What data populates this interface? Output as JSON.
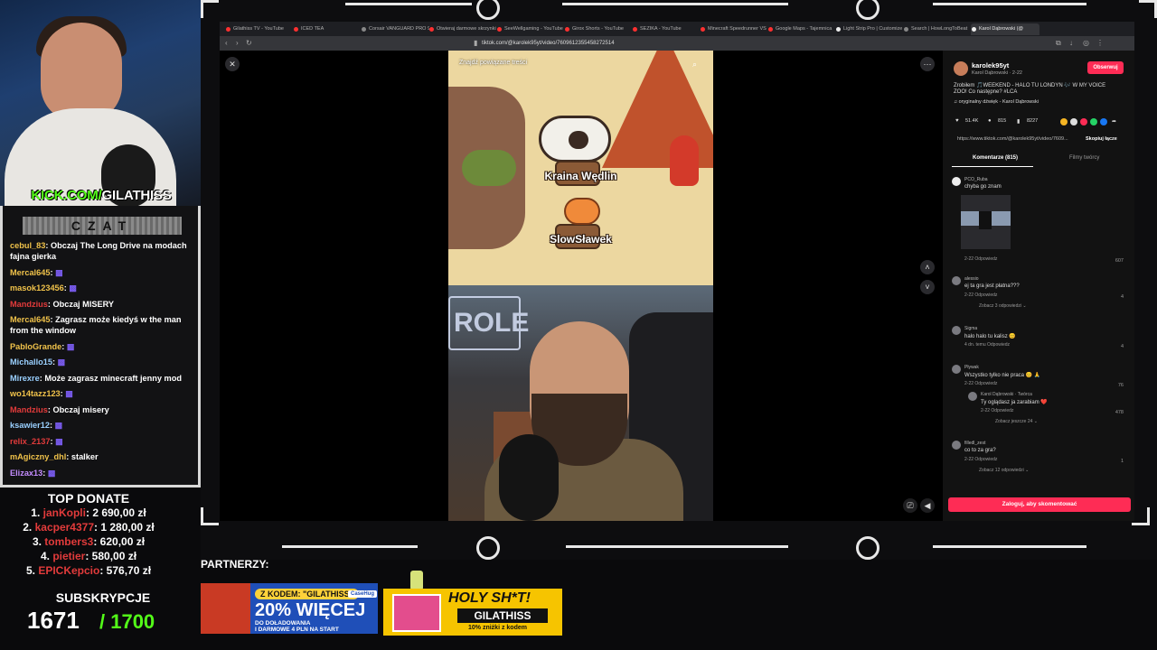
{
  "stream": {
    "kick_prefix": "KICK.COM/",
    "kick_name": "GILATHISS",
    "chat_title": "CZAT",
    "chat": [
      {
        "user": "cebul_83",
        "text": "Obczaj The Long Drive na modach fajna gierka",
        "style": "gold"
      },
      {
        "user": "Mercal645",
        "text": "",
        "style": "gold"
      },
      {
        "user": "masok123456",
        "text": "",
        "style": "gold"
      },
      {
        "user": "Mandzius",
        "text": "Obczaj MISERY",
        "style": "red"
      },
      {
        "user": "Mercal645",
        "text": "Zagrasz może kiedyś w the man from the window",
        "style": "gold"
      },
      {
        "user": "PabloGrande",
        "text": "",
        "style": "gold"
      },
      {
        "user": "Michallo15",
        "text": "",
        "style": "blue"
      },
      {
        "user": "Mirexre",
        "text": "Może zagrasz minecraft jenny mod",
        "style": "blue"
      },
      {
        "user": "wo14tazz123",
        "text": "",
        "style": "gold"
      },
      {
        "user": "Mandzius",
        "text": "Obczaj misery",
        "style": "red"
      },
      {
        "user": "ksawier12",
        "text": "",
        "style": "blue"
      },
      {
        "user": "relix_2137",
        "text": "",
        "style": "red"
      },
      {
        "user": "mAgiczny_dhl",
        "text": "stalker",
        "style": "gold"
      },
      {
        "user": "Elizax13",
        "text": "",
        "style": "pink"
      }
    ],
    "top_donate_title": "TOP DONATE",
    "donations": [
      {
        "rank": "1.",
        "name": "janKopli",
        "amount": "2 690,00 zł"
      },
      {
        "rank": "2.",
        "name": "kacper4377",
        "amount": "1 280,00 zł"
      },
      {
        "rank": "3.",
        "name": "tombers3",
        "amount": "620,00 zł"
      },
      {
        "rank": "4.",
        "name": "pietier",
        "amount": "580,00 zł"
      },
      {
        "rank": "5.",
        "name": "EPICKepcio",
        "amount": "576,70 zł"
      }
    ],
    "subs_title": "SUBSKRYPCJE",
    "subs_count": "1671",
    "subs_goal": "/ 1700",
    "partners_label": "PARTNERZY:",
    "partner1": {
      "code": "Z KODEM: \"GILATHISS\"",
      "line1": "20% WIĘCEJ",
      "line2": "DO DOŁADOWANIA",
      "line3": "I DARMOWE 4 PLN NA START",
      "brand": "CaseHug"
    },
    "partner2": {
      "title": "HOLY SH*T!",
      "code": "GILATHISS",
      "sub": "10% zniżki z kodem"
    }
  },
  "browser": {
    "tabs": [
      {
        "label": "Gilathiss TV - YouTube",
        "color": "#ff3030"
      },
      {
        "label": "ICED TEA",
        "color": "#ff3030"
      },
      {
        "label": "Corsair VANGUARD PRO 96",
        "color": "#888888"
      },
      {
        "label": "Otwieraj darmowe skrzynki",
        "color": "#ff3030"
      },
      {
        "label": "SeeWellgaming - YouTube",
        "color": "#ff3030"
      },
      {
        "label": "Girox Shorts - YouTube",
        "color": "#ff3030"
      },
      {
        "label": "SEZIKA - YouTube",
        "color": "#ff3030"
      },
      {
        "label": "Minecraft Speedrunner VS",
        "color": "#ff3030"
      },
      {
        "label": "Google Maps - Tajemnica",
        "color": "#ff3030"
      },
      {
        "label": "Light Strip Pro | Customize",
        "color": "#eeeeee"
      },
      {
        "label": "Search | HowLongToBeat",
        "color": "#888888"
      },
      {
        "label": "Karol Dąbrowski (@",
        "color": "#eeeeee"
      }
    ],
    "url": "tiktok.com/@karolek95yt/video/7609612355458272514"
  },
  "video": {
    "related_label": "Znajdź powiązane treści",
    "label_cow": "Kraina Wędlin",
    "label_snail": "SlowSławek",
    "cam_sign": "ROLE"
  },
  "panel": {
    "author_handle": "karolek95yt",
    "author_meta": "Karol Dąbrowski · 2-22",
    "follow_label": "Obserwuj",
    "caption_line1": "Zrobiłem 🎵WEEKEND - HALO TU LONDYN 🎶 W MY VOICE",
    "caption_line2": "ZOO! Co następne? #LCA",
    "sound": "♫ oryginalny dźwięk - Karol Dąbrowski",
    "likes": "51.4K",
    "comments_count": "815",
    "saves": "8227",
    "link": "https://www.tiktok.com/@karolek95yt/video/7609...",
    "copy_label": "Skopiuj łącze",
    "tab_comments": "Komentarze (815)",
    "tab_creator": "Filmy twórcy",
    "comments": [
      {
        "user": "PCO_Ruba",
        "text": "chyba go znam",
        "meta": "2-22   Odpowiedz",
        "likes": "607"
      },
      {
        "user": "alessio",
        "text": "ej ta gra jest płatna???",
        "meta": "2-22   Odpowiedz",
        "likes": "4",
        "more": "Zobacz 3 odpowiedzi ⌄"
      },
      {
        "user": "Sigma",
        "text": "halo halo tu kalisz 😊",
        "meta": "4 dn. temu   Odpowiedz",
        "likes": "4"
      },
      {
        "user": "Pływak",
        "text": "Wszystko tylko nie praca 😊 🙏",
        "meta": "2-22   Odpowiedz",
        "likes": "76"
      },
      {
        "user": "Karol Dąbrowski · Twórca",
        "text": "Ty oglądasz ja zarabiam ❤️",
        "meta": "2-22   Odpowiedz",
        "likes": "478",
        "more": "Zobacz jeszcze 24 ⌄"
      },
      {
        "user": "filledl_zest",
        "text": "co to za gra?",
        "meta": "2-22   Odpowiedz",
        "likes": "1",
        "more": "Zobacz 12 odpowiedzi ⌄"
      }
    ],
    "login_label": "Zaloguj, aby skomentować"
  }
}
